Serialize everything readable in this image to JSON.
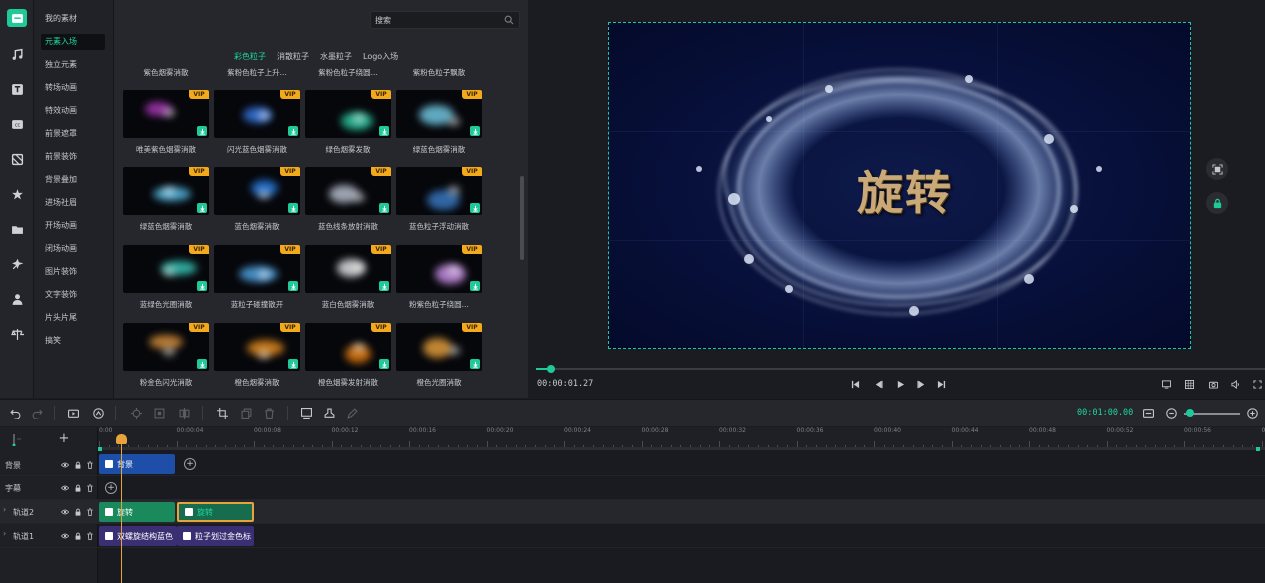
{
  "rail": [
    "materials-icon",
    "music-icon",
    "text-icon",
    "subtitle-icon",
    "filter-icon",
    "effects-icon",
    "folder-icon",
    "sticker-icon",
    "person-icon",
    "split-icon"
  ],
  "categories": [
    "我的素材",
    "元素入场",
    "独立元素",
    "转场动画",
    "特效动画",
    "前景遮罩",
    "前景装饰",
    "背景叠加",
    "进场社眉",
    "开场动画",
    "闭场动画",
    "图片装饰",
    "文字装饰",
    "片头片尾",
    "搞笑"
  ],
  "active_category": "元素入场",
  "search": {
    "placeholder": "搜索"
  },
  "subtabs": [
    "彩色粒子",
    "消散粒子",
    "水墨粒子",
    "Logo入场"
  ],
  "active_subtab": "彩色粒子",
  "top_captions": [
    "紫色烟雾消散",
    "紫粉色粒子上升...",
    "紫粉色粒子绕圆...",
    "紫粉色粒子飘散"
  ],
  "vip_label": "VIP",
  "items": [
    {
      "caption": "唯美紫色烟雾消散",
      "color": "#c13fd0"
    },
    {
      "caption": "闪光蓝色烟雾消散",
      "color": "#3d86ff"
    },
    {
      "caption": "绿色烟雾发散",
      "color": "#2fdcb0"
    },
    {
      "caption": "绿蓝色烟雾消散",
      "color": "#7fe0ff"
    },
    {
      "caption": "绿蓝色烟雾消散",
      "color": "#5fd0ff"
    },
    {
      "caption": "蓝色烟雾消散",
      "color": "#2d8cff"
    },
    {
      "caption": "蓝色线条放射消散",
      "color": "#cfd8e8"
    },
    {
      "caption": "蓝色粒子浮动消散",
      "color": "#3f86d8"
    },
    {
      "caption": "蓝绿色光圈消散",
      "color": "#40e0d0"
    },
    {
      "caption": "蓝粒子碰撞散开",
      "color": "#5ab8ff"
    },
    {
      "caption": "蓝白色烟雾消散",
      "color": "#ffffff"
    },
    {
      "caption": "粉紫色粒子绕圆...",
      "color": "#e0a0ff"
    },
    {
      "caption": "粉金色闪光消散",
      "color": "#f0a040"
    },
    {
      "caption": "橙色烟雾消散",
      "color": "#ff9a20"
    },
    {
      "caption": "橙色烟雾发射消散",
      "color": "#ff8a10"
    },
    {
      "caption": "橙色光圈消散",
      "color": "#ffb040"
    }
  ],
  "preview": {
    "title_text": "旋转",
    "timecode": "00:00:01.27",
    "progress": 0.02
  },
  "toolbar": {
    "duration": "00:01:00.00",
    "zoom": 0.1
  },
  "ruler": [
    "0:00",
    "00:00:04",
    "00:00:08",
    "00:00:12",
    "00:00:16",
    "00:00:20",
    "00:00:24",
    "00:00:28",
    "00:00:32",
    "00:00:36",
    "00:00:40",
    "00:00:44",
    "00:00:48",
    "00:00:52",
    "00:00:56",
    "00:01:0"
  ],
  "tracks": [
    {
      "name": "背景"
    },
    {
      "name": "字幕"
    },
    {
      "name": "轨道2"
    },
    {
      "name": "轨道1"
    }
  ],
  "clips": {
    "bg": "背景",
    "text": "旋转",
    "text2": "旋转",
    "fx1": "双螺旋结构蓝色",
    "fx2": "粒子划过金色标"
  },
  "colors": {
    "accent": "#1fc99a",
    "vip": "#f2a91c",
    "playhead": "#e8a33a"
  }
}
